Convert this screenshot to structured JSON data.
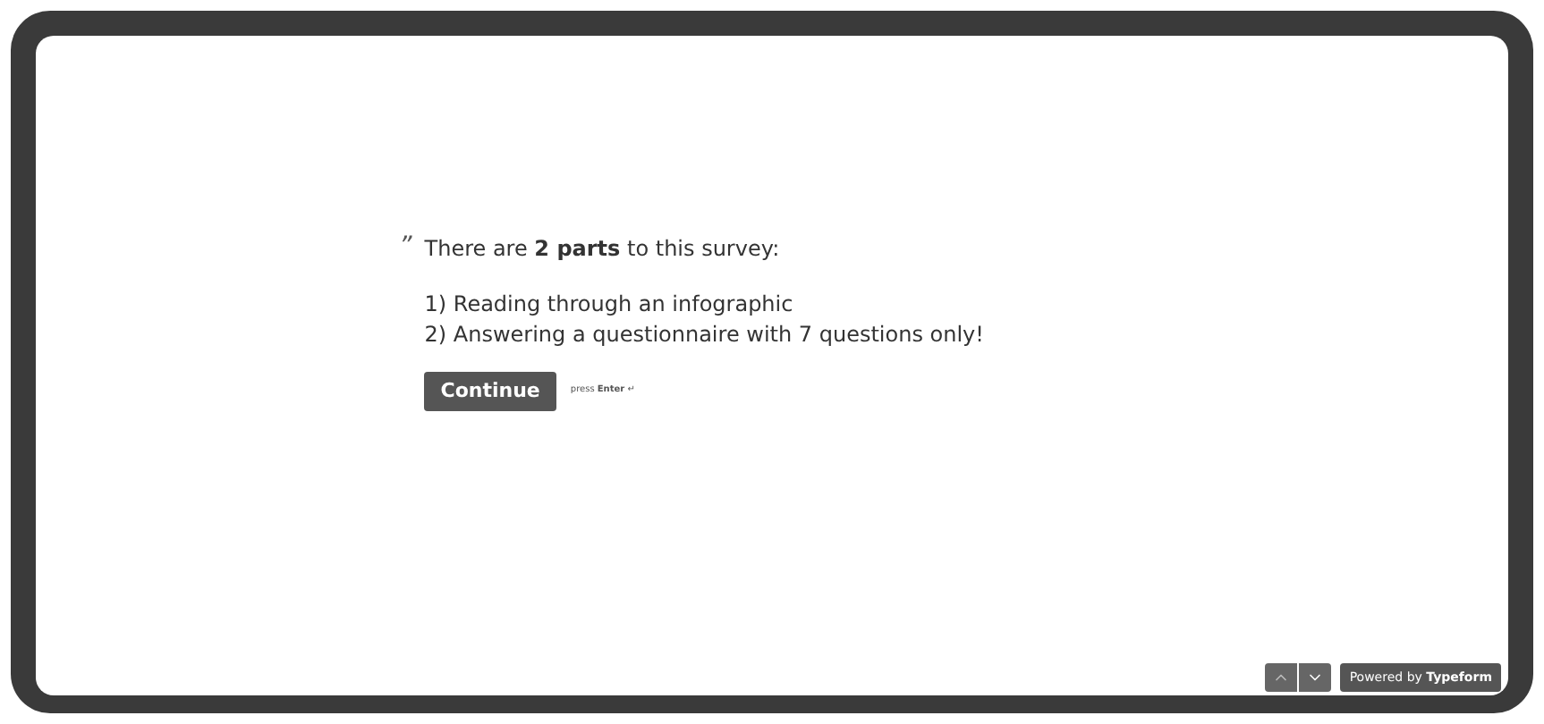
{
  "question": {
    "quote_mark": "”",
    "intro": "There are **2 parts** to this survey:",
    "lines": [
      "1) Reading through an infographic",
      "2) Answering a questionnaire with 7 questions only!"
    ]
  },
  "continue_button": {
    "label": "Continue",
    "hint": "press **Enter** ↵"
  },
  "footer": {
    "powered_by": "Powered by **Typeform**"
  }
}
